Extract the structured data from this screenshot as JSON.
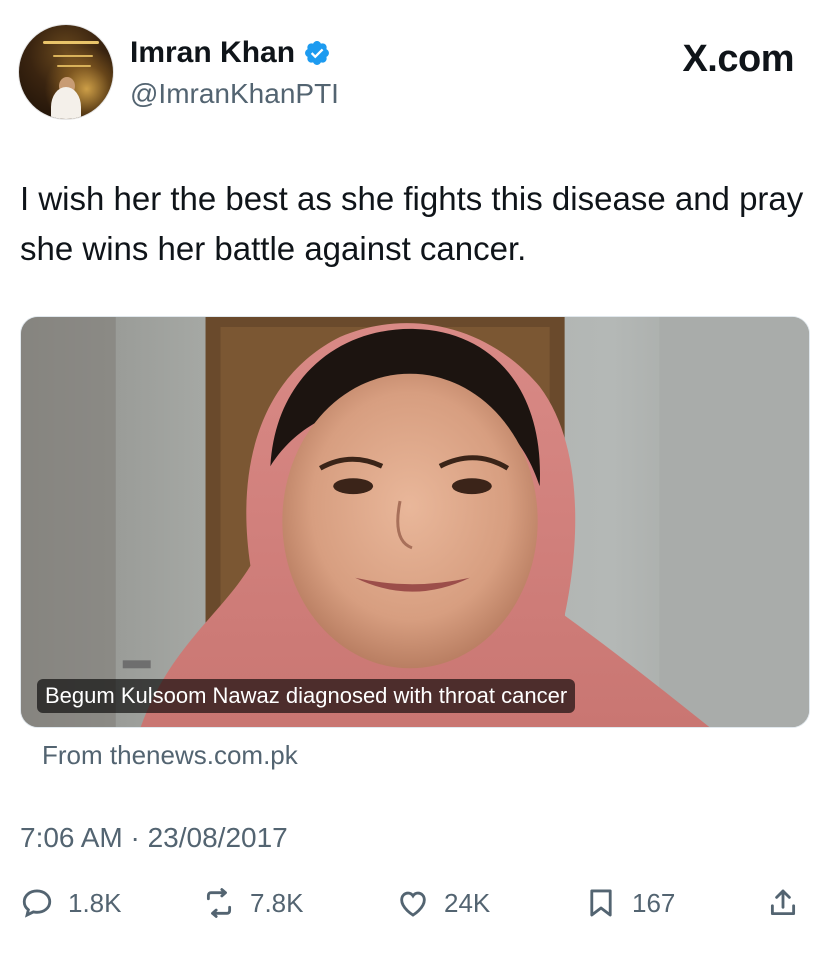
{
  "author": {
    "name": "Imran Khan",
    "handle": "@ImranKhanPTI",
    "verified": true
  },
  "brand": {
    "logo_text": "X.com"
  },
  "tweet": {
    "text": "I wish her the best as she fights this disease and pray she wins her battle against cancer.",
    "timestamp": "7:06 AM · 23/08/2017"
  },
  "card": {
    "caption": "Begum Kulsoom Nawaz diagnosed with throat cancer",
    "source": "From thenews.com.pk"
  },
  "actions": {
    "replies": "1.8K",
    "reposts": "7.8K",
    "likes": "24K",
    "bookmarks": "167"
  },
  "colors": {
    "verified_blue": "#1d9bf0",
    "secondary_text": "#536471",
    "primary_text": "#0f1419"
  },
  "icons": [
    "verified-badge-icon",
    "reply-icon",
    "repost-icon",
    "like-icon",
    "bookmark-icon",
    "share-icon"
  ]
}
